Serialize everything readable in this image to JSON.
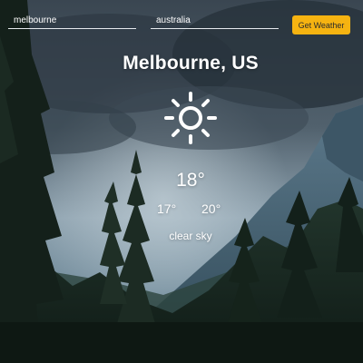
{
  "search": {
    "city_value": "melbourne",
    "country_value": "australia",
    "button_label": "Get Weather"
  },
  "weather": {
    "location": "Melbourne, US",
    "icon": "sun-icon",
    "temperature": "18°",
    "temp_min": "17°",
    "temp_max": "20°",
    "description": "clear sky"
  },
  "colors": {
    "accent": "#f6b311",
    "text": "#ffffff"
  }
}
